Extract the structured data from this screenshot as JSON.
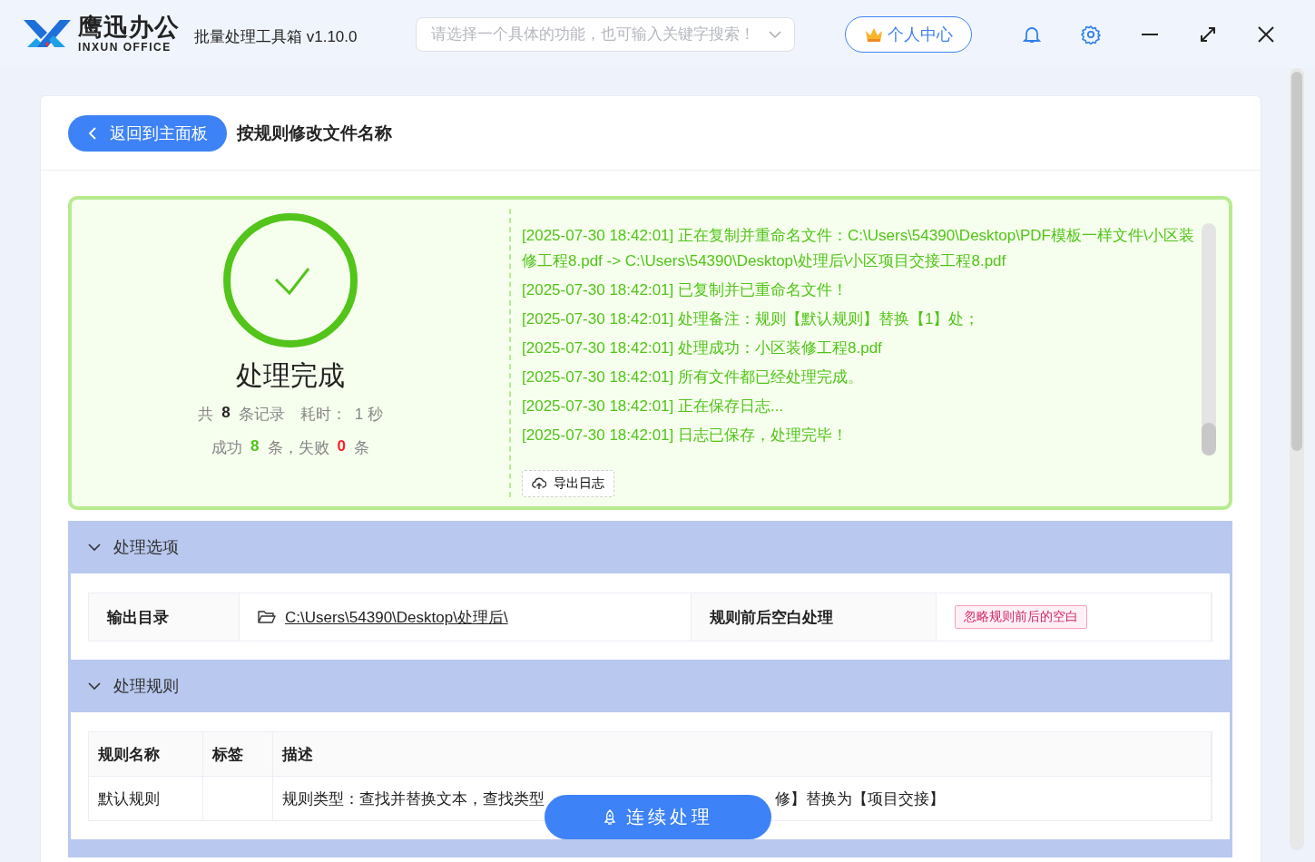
{
  "app": {
    "logo_name": "鹰迅办公",
    "logo_subtitle": "INXUN OFFICE",
    "title": "批量处理工具箱 v1.10.0"
  },
  "search": {
    "placeholder": "请选择一个具体的功能，也可输入关键字搜索！"
  },
  "user_button": "个人中心",
  "page": {
    "back_button": "返回到主面板",
    "title": "按规则修改文件名称"
  },
  "result": {
    "status": "处理完成",
    "summary": [
      [
        {
          "kind": "label",
          "text": "共"
        },
        {
          "kind": "count",
          "text": "8"
        },
        {
          "kind": "label",
          "text": "条记录"
        },
        {
          "kind": "gap",
          "text": "耗时："
        },
        {
          "kind": "label",
          "text": "1 秒"
        }
      ],
      [
        {
          "kind": "label",
          "text": "成功"
        },
        {
          "kind": "success",
          "text": "8"
        },
        {
          "kind": "label",
          "text": "条，失败"
        },
        {
          "kind": "fail",
          "text": "0"
        },
        {
          "kind": "label",
          "text": "条"
        }
      ]
    ]
  },
  "log": {
    "lines": [
      "[2025-07-30 18:42:01] 正在复制并重命名文件：C:\\Users\\54390\\Desktop\\PDF模板一样文件\\小区装修工程8.pdf -> C:\\Users\\54390\\Desktop\\处理后\\小区项目交接工程8.pdf",
      "[2025-07-30 18:42:01] 已复制并已重命名文件！",
      "[2025-07-30 18:42:01] 处理备注：规则【默认规则】替换【1】处；",
      "[2025-07-30 18:42:01] 处理成功：小区装修工程8.pdf",
      "[2025-07-30 18:42:01] 所有文件都已经处理完成。",
      "[2025-07-30 18:42:01] 正在保存日志...",
      "[2025-07-30 18:42:01] 日志已保存，处理完毕！"
    ],
    "export_button": "导出日志"
  },
  "sections": [
    {
      "kind": "options",
      "title": "处理选项",
      "expanded": true,
      "fields": [
        {
          "kind": "link",
          "label": "输出目录",
          "value": "C:\\Users\\54390\\Desktop\\处理后\\"
        },
        {
          "kind": "tag",
          "label": "规则前后空白处理",
          "value": "忽略规则前后的空白"
        }
      ]
    },
    {
      "kind": "rules",
      "title": "处理规则",
      "expanded": true,
      "columns": [
        "规则名称",
        "标签",
        "描述"
      ],
      "rows": [
        {
          "name": "默认规则",
          "description_parts": [
            "规则类型：查找并替换文本，查找类型",
            "修】替换为【项目交接】"
          ]
        }
      ]
    }
  ],
  "float_button": "连续处理"
}
